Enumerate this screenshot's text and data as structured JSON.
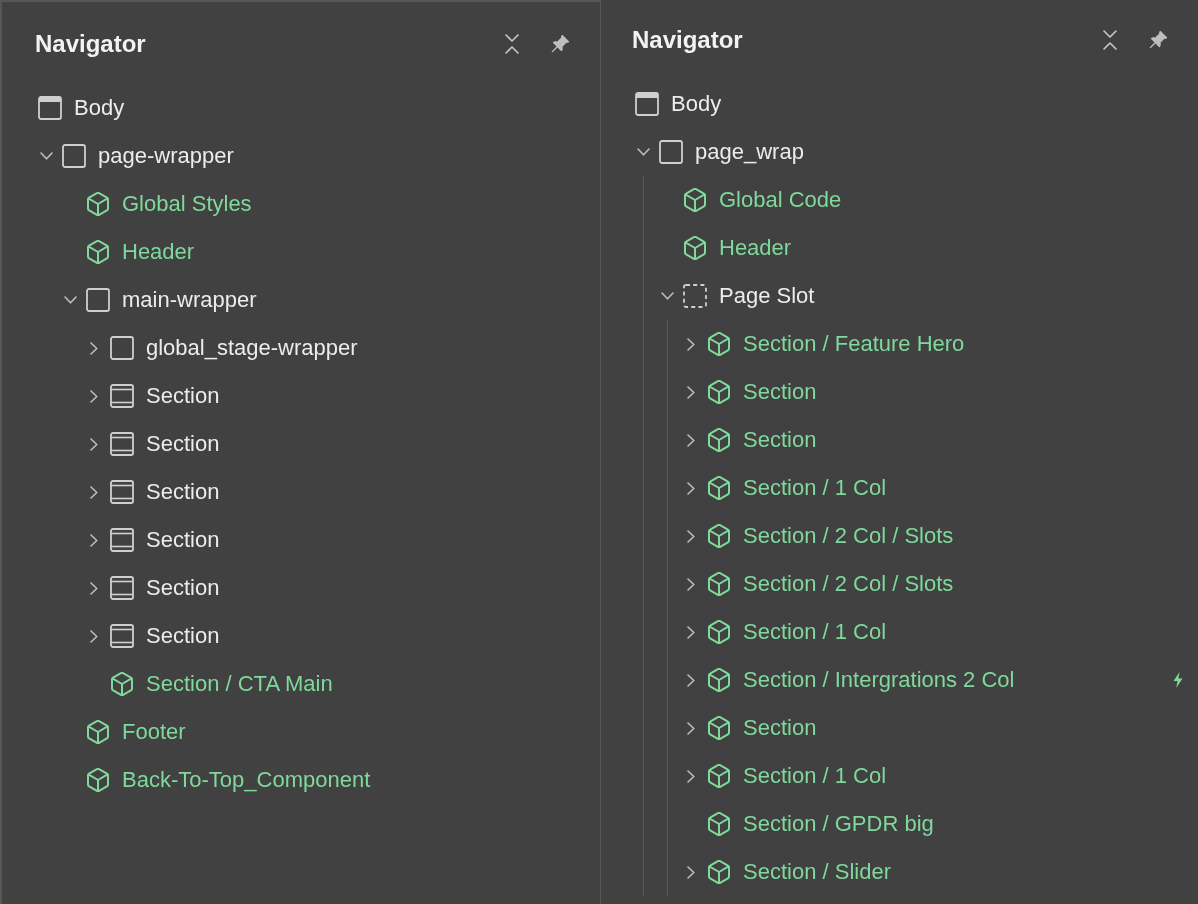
{
  "panels": [
    {
      "title": "Navigator",
      "guide_lines": false,
      "tree": [
        {
          "label": "Body",
          "kind": "body",
          "children": [
            {
              "label": "page-wrapper",
              "kind": "div",
              "expanded": true,
              "children": [
                {
                  "label": "Global Styles",
                  "kind": "component"
                },
                {
                  "label": "Header",
                  "kind": "component"
                },
                {
                  "label": "main-wrapper",
                  "kind": "div",
                  "expanded": true,
                  "children": [
                    {
                      "label": "global_stage-wrapper",
                      "kind": "div",
                      "expanded": false
                    },
                    {
                      "label": "Section",
                      "kind": "section",
                      "expanded": false
                    },
                    {
                      "label": "Section",
                      "kind": "section",
                      "expanded": false
                    },
                    {
                      "label": "Section",
                      "kind": "section",
                      "expanded": false
                    },
                    {
                      "label": "Section",
                      "kind": "section",
                      "expanded": false
                    },
                    {
                      "label": "Section",
                      "kind": "section",
                      "expanded": false
                    },
                    {
                      "label": "Section",
                      "kind": "section",
                      "expanded": false
                    },
                    {
                      "label": "Section / CTA Main",
                      "kind": "component"
                    }
                  ]
                },
                {
                  "label": "Footer",
                  "kind": "component"
                },
                {
                  "label": "Back-To-Top_Component",
                  "kind": "component"
                }
              ]
            }
          ]
        }
      ]
    },
    {
      "title": "Navigator",
      "guide_lines": true,
      "tree": [
        {
          "label": "Body",
          "kind": "body",
          "children": [
            {
              "label": "page_wrap",
              "kind": "div",
              "expanded": true,
              "children": [
                {
                  "label": "Global Code",
                  "kind": "component"
                },
                {
                  "label": "Header",
                  "kind": "component"
                },
                {
                  "label": "Page Slot",
                  "kind": "slot",
                  "expanded": true,
                  "children": [
                    {
                      "label": "Section / Feature Hero",
                      "kind": "component",
                      "expanded": false,
                      "interaction": false
                    },
                    {
                      "label": "Section",
                      "kind": "component",
                      "expanded": false,
                      "interaction": false
                    },
                    {
                      "label": "Section",
                      "kind": "component",
                      "expanded": false,
                      "interaction": false
                    },
                    {
                      "label": "Section / 1 Col",
                      "kind": "component",
                      "expanded": false,
                      "interaction": false
                    },
                    {
                      "label": "Section / 2 Col / Slots",
                      "kind": "component",
                      "expanded": false,
                      "interaction": false
                    },
                    {
                      "label": "Section / 2 Col / Slots",
                      "kind": "component",
                      "expanded": false,
                      "interaction": false
                    },
                    {
                      "label": "Section / 1 Col",
                      "kind": "component",
                      "expanded": false,
                      "interaction": false
                    },
                    {
                      "label": "Section / Intergrations 2 Col",
                      "kind": "component",
                      "expanded": false,
                      "interaction": true
                    },
                    {
                      "label": "Section",
                      "kind": "component",
                      "expanded": false,
                      "interaction": false
                    },
                    {
                      "label": "Section / 1 Col",
                      "kind": "component",
                      "expanded": false,
                      "interaction": false
                    },
                    {
                      "label": "Section / GPDR big",
                      "kind": "component",
                      "interaction": false
                    },
                    {
                      "label": "Section / Slider",
                      "kind": "component",
                      "expanded": false,
                      "interaction": false
                    }
                  ]
                }
              ]
            }
          ]
        }
      ]
    }
  ]
}
